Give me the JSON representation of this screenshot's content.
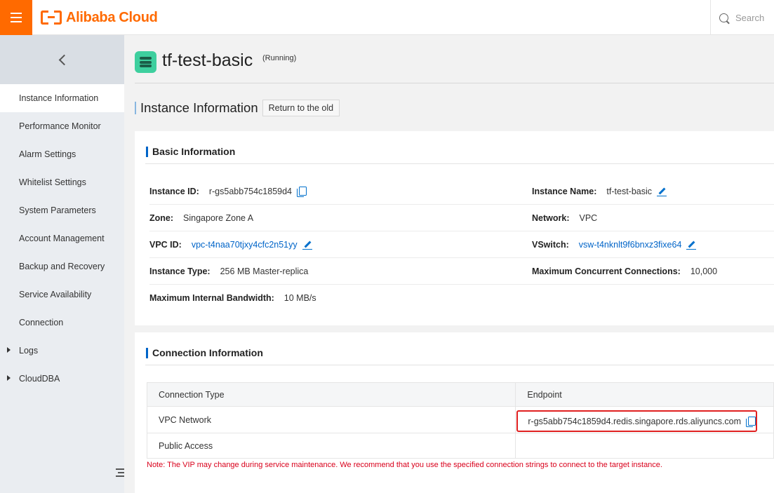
{
  "header": {
    "brand": "Alibaba Cloud",
    "search_placeholder": "Search",
    "accent_color": "#ff6a00"
  },
  "sidebar": {
    "items": [
      {
        "label": "Instance Information",
        "active": true
      },
      {
        "label": "Performance Monitor"
      },
      {
        "label": "Alarm Settings"
      },
      {
        "label": "Whitelist Settings"
      },
      {
        "label": "System Parameters"
      },
      {
        "label": "Account Management"
      },
      {
        "label": "Backup and Recovery"
      },
      {
        "label": "Service Availability"
      },
      {
        "label": "Connection"
      },
      {
        "label": "Logs",
        "expandable": true
      },
      {
        "label": "CloudDBA",
        "expandable": true
      }
    ]
  },
  "instance": {
    "name": "tf-test-basic",
    "status": "(Running)"
  },
  "section": {
    "title": "Instance Information",
    "return_label": "Return to the old"
  },
  "basic": {
    "title": "Basic Information",
    "instance_id_label": "Instance ID:",
    "instance_id": "r-gs5abb754c1859d4",
    "instance_name_label": "Instance Name:",
    "instance_name": "tf-test-basic",
    "zone_label": "Zone:",
    "zone": "Singapore Zone A",
    "network_label": "Network:",
    "network": "VPC",
    "vpc_id_label": "VPC ID:",
    "vpc_id": "vpc-t4naa70tjxy4cfc2n51yy",
    "vswitch_label": "VSwitch:",
    "vswitch": "vsw-t4nknlt9f6bnxz3fixe64",
    "instance_type_label": "Instance Type:",
    "instance_type": "256 MB Master-replica",
    "max_conn_label": "Maximum Concurrent Connections:",
    "max_conn": "10,000",
    "bandwidth_label": "Maximum Internal Bandwidth:",
    "bandwidth": "10 MB/s"
  },
  "connection": {
    "title": "Connection Information",
    "col_type": "Connection Type",
    "col_endpoint": "Endpoint",
    "rows": [
      {
        "type": "VPC Network",
        "endpoint": "r-gs5abb754c1859d4.redis.singapore.rds.aliyuncs.com"
      },
      {
        "type": "Public Access",
        "endpoint": ""
      }
    ],
    "note": "Note: The VIP may change during service maintenance. We recommend that you use the specified connection strings to connect to the target instance.",
    "highlight_color": "#e02020"
  }
}
